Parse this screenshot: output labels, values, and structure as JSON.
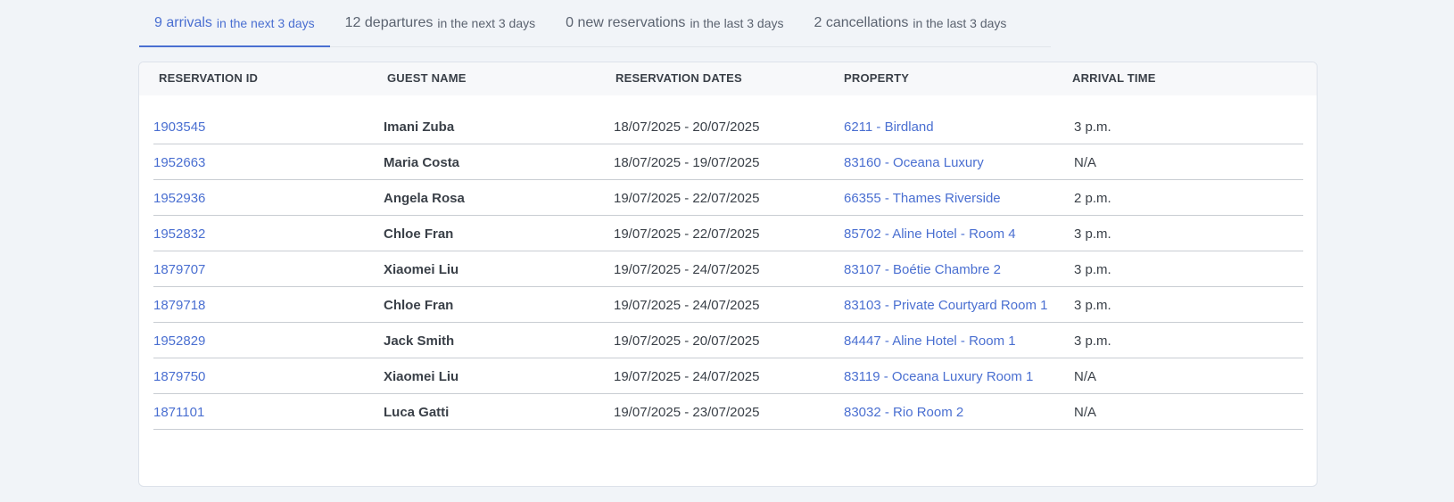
{
  "tabs": [
    {
      "count": "9 arrivals",
      "range": "in the next 3 days",
      "active": true
    },
    {
      "count": "12 departures",
      "range": "in the next 3 days",
      "active": false
    },
    {
      "count": "0 new reservations",
      "range": "in the last 3 days",
      "active": false
    },
    {
      "count": "2 cancellations",
      "range": "in the last 3 days",
      "active": false
    }
  ],
  "table": {
    "headers": [
      "RESERVATION ID",
      "GUEST NAME",
      "RESERVATION DATES",
      "PROPERTY",
      "ARRIVAL TIME"
    ],
    "rows": [
      {
        "id": "1903545",
        "guest": "Imani Zuba",
        "dates": "18/07/2025 - 20/07/2025",
        "property": "6211 - Birdland",
        "time": "3 p.m."
      },
      {
        "id": "1952663",
        "guest": "Maria Costa",
        "dates": "18/07/2025 - 19/07/2025",
        "property": "83160 - Oceana Luxury",
        "time": "N/A"
      },
      {
        "id": "1952936",
        "guest": "Angela Rosa",
        "dates": "19/07/2025 - 22/07/2025",
        "property": "66355 - Thames Riverside",
        "time": "2 p.m."
      },
      {
        "id": "1952832",
        "guest": "Chloe Fran",
        "dates": "19/07/2025 - 22/07/2025",
        "property": "85702 - Aline Hotel - Room 4",
        "time": "3 p.m."
      },
      {
        "id": "1879707",
        "guest": "Xiaomei Liu",
        "dates": "19/07/2025 - 24/07/2025",
        "property": "83107 - Boétie Chambre 2",
        "time": "3 p.m."
      },
      {
        "id": "1879718",
        "guest": "Chloe Fran",
        "dates": "19/07/2025 - 24/07/2025",
        "property": "83103 - Private Courtyard Room 1",
        "time": "3 p.m."
      },
      {
        "id": "1952829",
        "guest": "Jack Smith",
        "dates": "19/07/2025 - 20/07/2025",
        "property": "84447 - Aline Hotel - Room 1",
        "time": "3 p.m."
      },
      {
        "id": "1879750",
        "guest": "Xiaomei Liu",
        "dates": "19/07/2025 - 24/07/2025",
        "property": "83119 - Oceana Luxury Room 1",
        "time": "N/A"
      },
      {
        "id": "1871101",
        "guest": "Luca Gatti",
        "dates": "19/07/2025 - 23/07/2025",
        "property": "83032 - Rio Room 2",
        "time": "N/A"
      }
    ]
  },
  "colors": {
    "accent": "#4a6fd1",
    "background": "#f1f4f8",
    "text": "#3a4048"
  }
}
